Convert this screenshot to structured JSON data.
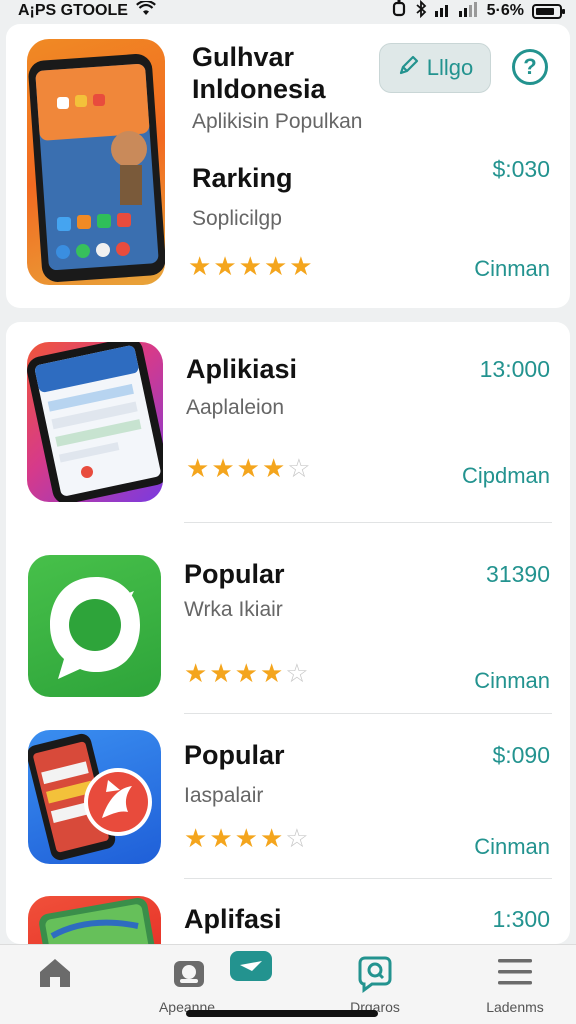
{
  "status_bar": {
    "carrier": "A¡PS GTOOLE",
    "battery": "5·6%",
    "battery_level": 0.8,
    "icons": [
      "wifi-icon",
      "alarm-icon",
      "bluetooth-icon",
      "signal-icon",
      "battery-icon"
    ]
  },
  "featured": {
    "title_line1": "Gulhvar",
    "title_line2": "Inldonesia",
    "subtitle": "Aplikisin Populkan",
    "action_button_label": "Lllgo",
    "ranking_label": "Rarking",
    "ranking_sub": "Soplicilgp",
    "price": "$:030",
    "rating": 4.5,
    "action": "Cinman"
  },
  "apps": [
    {
      "title": "Aplikiasi",
      "subtitle": "Aaplaleion",
      "price": "13:000",
      "rating": 3.5,
      "action": "Cipdman",
      "icon": "phone-app-icon"
    },
    {
      "title": "Popular",
      "subtitle": "Wrka Ikiair",
      "price": "31390",
      "rating": 4,
      "action": "Cinman",
      "icon": "chat-app-icon"
    },
    {
      "title": "Popular",
      "subtitle": "Iaspalair",
      "price": "$:090",
      "rating": 4,
      "action": "Cinman",
      "icon": "phone-fox-app-icon"
    },
    {
      "title": "Aplifasi",
      "subtitle": "",
      "price": "1:300",
      "rating": 0,
      "action": "",
      "icon": "map-app-icon"
    }
  ],
  "bottom_nav": [
    {
      "label": "",
      "icon": "home-icon"
    },
    {
      "label": "Apeanne",
      "icon": "app-store-icon"
    },
    {
      "label": "",
      "icon": "message-icon"
    },
    {
      "label": "Drqaros",
      "icon": "search-chat-icon"
    },
    {
      "label": "Ladenms",
      "icon": "menu-icon"
    }
  ],
  "colors": {
    "accent": "#23938f",
    "star": "#f4a51d",
    "background": "#eef0f1"
  }
}
